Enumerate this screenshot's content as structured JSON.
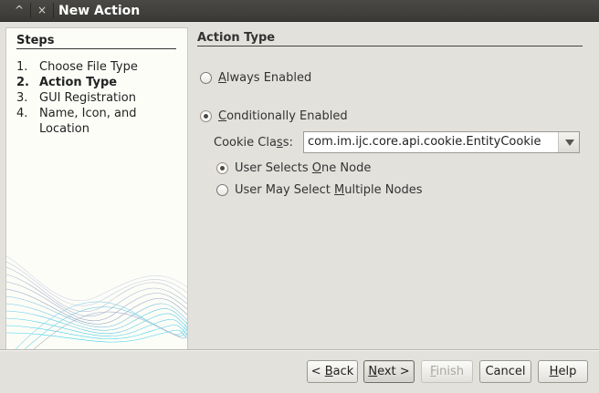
{
  "window": {
    "title": "New Action",
    "minimize_glyph": "^",
    "close_glyph": "×"
  },
  "steps": {
    "heading": "Steps",
    "items": [
      {
        "num": "1.",
        "label": "Choose File Type"
      },
      {
        "num": "2.",
        "label": "Action Type"
      },
      {
        "num": "3.",
        "label": "GUI Registration"
      },
      {
        "num": "4.",
        "label": "Name, Icon, and Location"
      }
    ],
    "current_index": 1
  },
  "panel": {
    "title": "Action Type",
    "always_enabled": {
      "pre": "",
      "mnemonic": "A",
      "post": "lways Enabled",
      "selected": false
    },
    "conditionally_enabled": {
      "pre": "",
      "mnemonic": "C",
      "post": "onditionally Enabled",
      "selected": true
    },
    "cookie_class": {
      "label_pre": "Cookie Cla",
      "label_mnemonic": "s",
      "label_post": "s:",
      "value": "com.im.ijc.core.api.cookie.EntityCookie"
    },
    "one_node": {
      "pre": "User Selects ",
      "mnemonic": "O",
      "post": "ne Node",
      "selected": true
    },
    "multiple_nodes": {
      "pre": "User May Select ",
      "mnemonic": "M",
      "post": "ultiple Nodes",
      "selected": false
    }
  },
  "buttons": {
    "back": {
      "pre": "< ",
      "mnemonic": "B",
      "post": "ack"
    },
    "next": {
      "pre": "",
      "mnemonic": "N",
      "post": "ext >"
    },
    "finish": {
      "pre": "",
      "mnemonic": "F",
      "post": "inish"
    },
    "cancel": {
      "label": "Cancel"
    },
    "help": {
      "pre": "",
      "mnemonic": "H",
      "post": "elp"
    }
  },
  "icons": {
    "minimize": "chevron-up-icon",
    "close": "close-icon",
    "combo_arrow": "triangle-down-icon"
  }
}
